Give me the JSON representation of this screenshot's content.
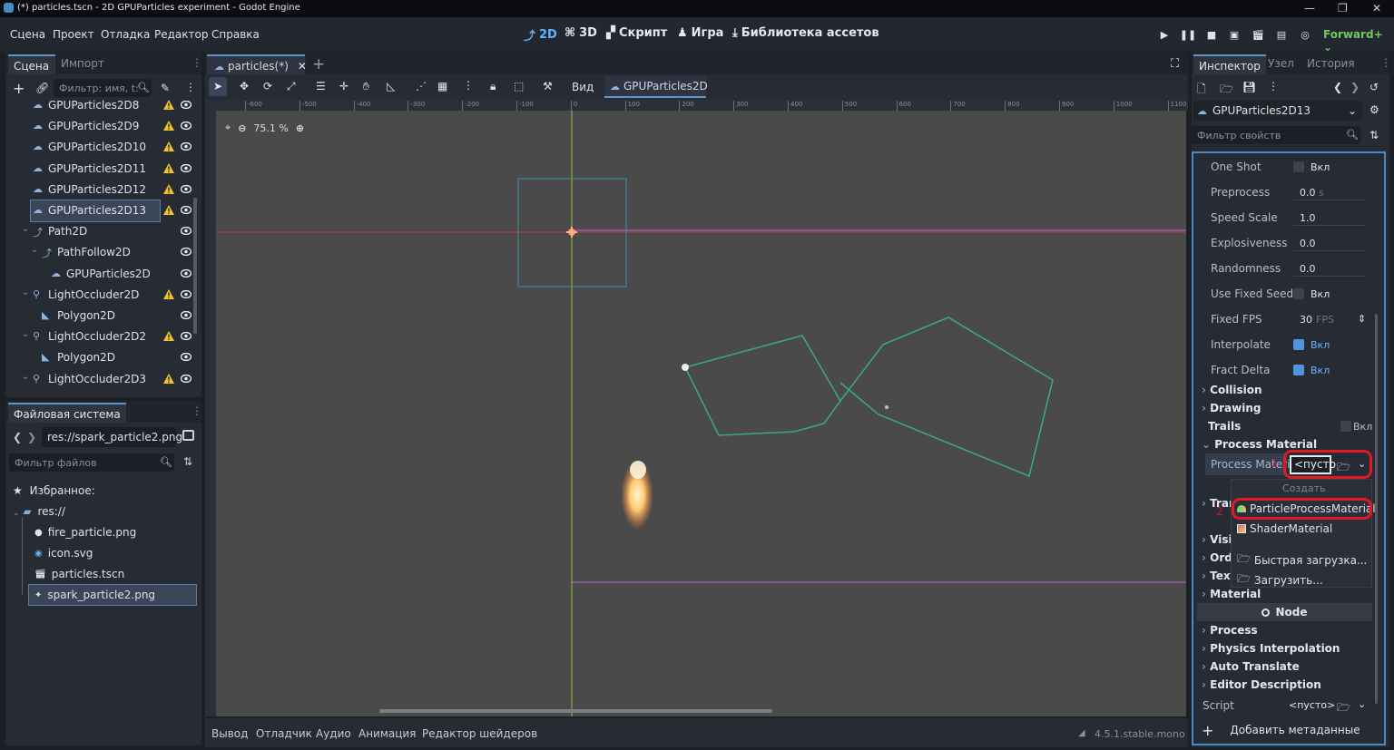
{
  "window": {
    "title": "(*) particles.tscn - 2D GPUParticles experiment - Godot Engine"
  },
  "menu": [
    "Сцена",
    "Проект",
    "Отладка",
    "Редактор",
    "Справка"
  ],
  "workspaces": {
    "w2d": "2D",
    "w3d": "3D",
    "script": "Скрипт",
    "game": "Игра",
    "assetlib": "Библиотека ассетов"
  },
  "renderer": "Forward+",
  "scene_dock": {
    "tab_scene": "Сцена",
    "tab_import": "Импорт",
    "filter_placeholder": "Фильтр: имя, t:",
    "nodes": [
      {
        "label": "GPUParticles2D8",
        "warn": true
      },
      {
        "label": "GPUParticles2D9",
        "warn": true
      },
      {
        "label": "GPUParticles2D10",
        "warn": true
      },
      {
        "label": "GPUParticles2D11",
        "warn": true
      },
      {
        "label": "GPUParticles2D12",
        "warn": true
      },
      {
        "label": "GPUParticles2D13",
        "warn": true
      },
      {
        "label": "Path2D",
        "warn": false
      },
      {
        "label": "PathFollow2D",
        "warn": false
      },
      {
        "label": "GPUParticles2D",
        "warn": false
      },
      {
        "label": "LightOccluder2D",
        "warn": true
      },
      {
        "label": "Polygon2D",
        "warn": false
      },
      {
        "label": "LightOccluder2D2",
        "warn": true
      },
      {
        "label": "Polygon2D",
        "warn": false
      },
      {
        "label": "LightOccluder2D3",
        "warn": true
      }
    ]
  },
  "filesystem": {
    "title": "Файловая система",
    "path": "res://spark_particle2.png",
    "filter_placeholder": "Фильтр файлов",
    "favorites": "Избранное:",
    "root": "res://",
    "files": [
      "fire_particle.png",
      "icon.svg",
      "particles.tscn",
      "spark_particle2.png"
    ]
  },
  "editor": {
    "scene_tab": "particles(*)",
    "view_menu": "Вид",
    "node_button": "GPUParticles2D",
    "zoom": "75.1 %",
    "ruler": [
      "-600",
      "-500",
      "-400",
      "-300",
      "-200",
      "-100",
      "0",
      "100",
      "200",
      "300",
      "400",
      "500",
      "600",
      "700",
      "800",
      "900",
      "1000",
      "1100"
    ]
  },
  "inspector": {
    "tab_inspector": "Инспектор",
    "tab_node": "Узел",
    "tab_history": "История",
    "object_name": "GPUParticles2D13",
    "filter_placeholder": "Фильтр свойств",
    "props": {
      "one_shot": {
        "label": "One Shot",
        "value": "Вкл"
      },
      "preprocess": {
        "label": "Preprocess",
        "value": "0.0",
        "unit": "s"
      },
      "speed_scale": {
        "label": "Speed Scale",
        "value": "1.0"
      },
      "explosiveness": {
        "label": "Explosiveness",
        "value": "0.0"
      },
      "randomness": {
        "label": "Randomness",
        "value": "0.0"
      },
      "fixed_seed": {
        "label": "Use Fixed Seed",
        "value": "Вкл"
      },
      "fixed_fps": {
        "label": "Fixed FPS",
        "value": "30",
        "unit": "FPS"
      },
      "interpolate": {
        "label": "Interpolate",
        "value": "Вкл"
      },
      "fract_delta": {
        "label": "Fract Delta",
        "value": "Вкл"
      }
    },
    "sections": {
      "collision": "Collision",
      "drawing": "Drawing",
      "trails": "Trails",
      "trails_value": "Вкл",
      "process_material": "Process Material",
      "material": "Material",
      "node": "Node",
      "process": "Process",
      "physics_interpolation": "Physics Interpolation",
      "auto_translate": "Auto Translate",
      "editor_description": "Editor Description"
    },
    "clipped_sections": [
      "Tran",
      "Visib",
      "Orde",
      "Textu"
    ],
    "process_material_label": "Process Materi",
    "process_material_value": "<пусто",
    "script_label": "Script",
    "script_value": "<пусто>",
    "add_metadata": "Добавить метаданные",
    "annotations": [
      "1",
      "2"
    ]
  },
  "dropdown": {
    "header": "Создать",
    "items": [
      "ParticleProcessMaterial",
      "ShaderMaterial",
      "Быстрая загрузка...",
      "Загрузить..."
    ]
  },
  "bottom_panel": {
    "tabs": [
      "Вывод",
      "Отладчик",
      "Аудио",
      "Анимация",
      "Редактор шейдеров"
    ],
    "version": "4.5.1.stable.mono"
  },
  "colors": {
    "accent": "#5fb2ff",
    "highlight_red": "#e01828",
    "path_green": "#3aa88a",
    "warn_yellow": "#f2c230"
  }
}
